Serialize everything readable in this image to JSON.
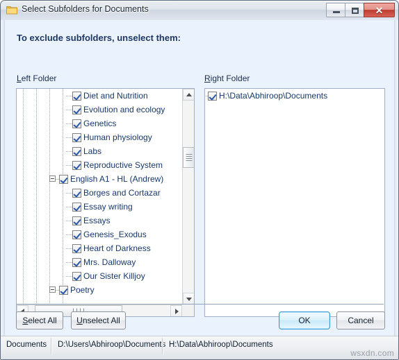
{
  "window": {
    "title": "Select Subfolders for Documents",
    "icon": "folder-icon",
    "controls": {
      "minimize": "–",
      "maximize": "□",
      "close": "✕"
    }
  },
  "heading": "To exclude subfolders, unselect them:",
  "labels": {
    "left_folder_acc": "L",
    "left_folder_rest": "eft Folder",
    "right_folder_acc": "R",
    "right_folder_rest": "ight Folder"
  },
  "left_tree": [
    {
      "label": "Diet and Nutrition",
      "checked": true,
      "indent": 4,
      "expander": "none"
    },
    {
      "label": "Evolution and ecology",
      "checked": true,
      "indent": 4,
      "expander": "none"
    },
    {
      "label": "Genetics",
      "checked": true,
      "indent": 4,
      "expander": "none"
    },
    {
      "label": "Human physiology",
      "checked": true,
      "indent": 4,
      "expander": "none"
    },
    {
      "label": "Labs",
      "checked": true,
      "indent": 4,
      "expander": "none"
    },
    {
      "label": "Reproductive System",
      "checked": true,
      "indent": 4,
      "expander": "none"
    },
    {
      "label": "English A1 - HL (Andrew)",
      "checked": true,
      "indent": 3,
      "expander": "minus"
    },
    {
      "label": "Borges and Cortazar",
      "checked": true,
      "indent": 4,
      "expander": "none"
    },
    {
      "label": "Essay writing",
      "checked": true,
      "indent": 4,
      "expander": "none"
    },
    {
      "label": "Essays",
      "checked": true,
      "indent": 4,
      "expander": "none"
    },
    {
      "label": "Genesis_Exodus",
      "checked": true,
      "indent": 4,
      "expander": "none"
    },
    {
      "label": "Heart of Darkness",
      "checked": true,
      "indent": 4,
      "expander": "none"
    },
    {
      "label": "Mrs. Dalloway",
      "checked": true,
      "indent": 4,
      "expander": "none"
    },
    {
      "label": "Our Sister Killjoy",
      "checked": true,
      "indent": 4,
      "expander": "none"
    },
    {
      "label": "Poetry",
      "checked": true,
      "indent": 3,
      "expander": "minus"
    }
  ],
  "right_tree": [
    {
      "label": "H:\\Data\\Abhiroop\\Documents",
      "checked": true,
      "indent": 0,
      "expander": "none"
    }
  ],
  "buttons": {
    "select_all_acc": "S",
    "select_all_rest": "elect All",
    "unselect_all_acc": "U",
    "unselect_all_rest": "nselect All",
    "ok": "OK",
    "cancel": "Cancel"
  },
  "statusbar": {
    "cell1": "Documents",
    "cell2": "D:\\Users\\Abhiroop\\Documents",
    "cell3": "H:\\Data\\Abhiroop\\Documents"
  },
  "watermark": "wsxdn.com",
  "colors": {
    "dialog_bg": "#eaf2fd",
    "heading": "#1f3864",
    "tree_text": "#17386a",
    "check": "#2b57a8",
    "default_button_border": "#3c9bd4",
    "close_button": "#bc3c30"
  }
}
